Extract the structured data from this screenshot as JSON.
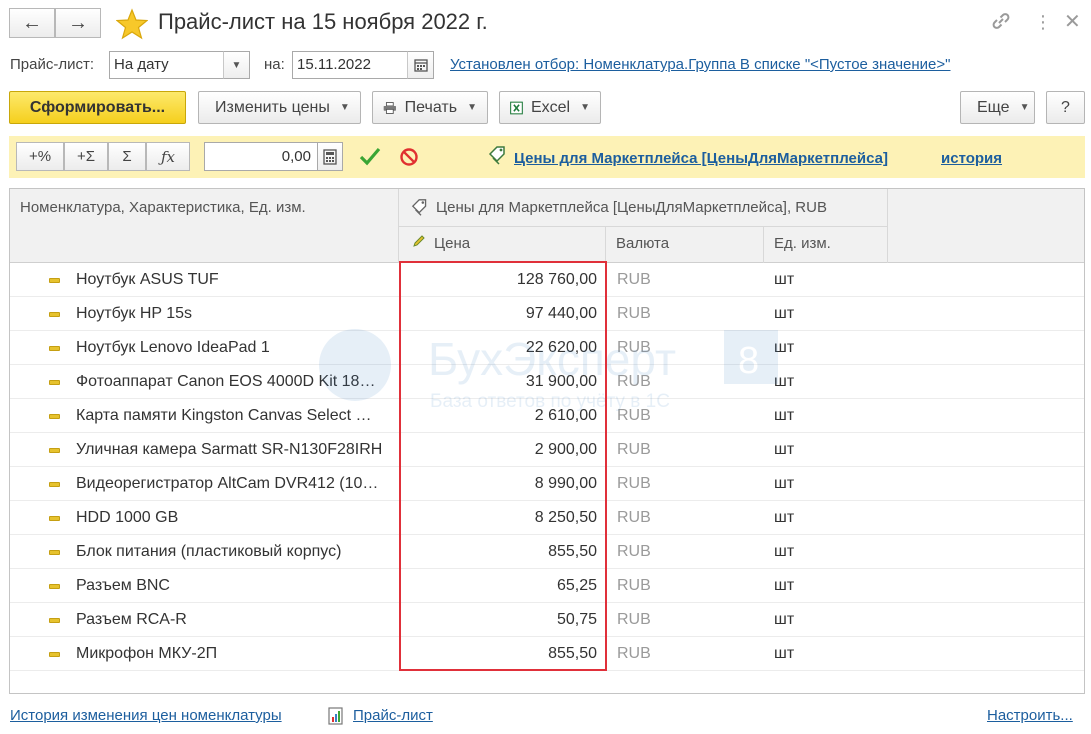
{
  "window": {
    "title": "Прайс-лист на 15 ноября 2022 г.",
    "back_icon": "arrow-left-icon",
    "forward_icon": "arrow-right-icon"
  },
  "params": {
    "pricelist_label": "Прайс-лист:",
    "pricelist_value": "На дату",
    "date_label": "на:",
    "date_value": "15.11.2022",
    "filter_link": "Установлен отбор: Номенклатура.Группа В списке \"<Пустое значение>\""
  },
  "toolbar": {
    "generate": "Сформировать...",
    "change_prices": "Изменить цены",
    "print": "Печать",
    "excel": "Excel",
    "more": "Еще",
    "help": "?"
  },
  "panel": {
    "pct": "+%",
    "add_sum": "+Σ",
    "sum": "Σ",
    "fx": "ƒx",
    "amount": "0,00",
    "price_type_link": "Цены для Маркетплейса [ЦеныДляМаркетплейса]",
    "history_link": "история"
  },
  "table": {
    "col_item": "Номенклатура, Характеристика, Ед. изм.",
    "group_header": "Цены для Маркетплейса [ЦеныДляМаркетплейса], RUB",
    "col_price": "Цена",
    "col_currency": "Валюта",
    "col_unit": "Ед. изм.",
    "rows": [
      {
        "name": "Ноутбук ASUS TUF",
        "price": "128 760,00",
        "currency": "RUB",
        "unit": "шт"
      },
      {
        "name": "Ноутбук HP 15s",
        "price": "97 440,00",
        "currency": "RUB",
        "unit": "шт"
      },
      {
        "name": "Ноутбук Lenovo IdeaPad 1",
        "price": "22 620,00",
        "currency": "RUB",
        "unit": "шт"
      },
      {
        "name": "Фотоаппарат Canon EOS 4000D Kit 18…",
        "price": "31 900,00",
        "currency": "RUB",
        "unit": "шт"
      },
      {
        "name": "Карта памяти Kingston Canvas Select …",
        "price": "2 610,00",
        "currency": "RUB",
        "unit": "шт"
      },
      {
        "name": "Уличная камера Sarmatt SR-N130F28IRH",
        "price": "2 900,00",
        "currency": "RUB",
        "unit": "шт"
      },
      {
        "name": "Видеорегистратор AltCam DVR412 (10…",
        "price": "8 990,00",
        "currency": "RUB",
        "unit": "шт"
      },
      {
        "name": "HDD 1000 GB",
        "price": "8 250,50",
        "currency": "RUB",
        "unit": "шт"
      },
      {
        "name": "Блок питания (пластиковый корпус)",
        "price": "855,50",
        "currency": "RUB",
        "unit": "шт"
      },
      {
        "name": "Разъем BNC",
        "price": "65,25",
        "currency": "RUB",
        "unit": "шт"
      },
      {
        "name": "Разъем RCA-R",
        "price": "50,75",
        "currency": "RUB",
        "unit": "шт"
      },
      {
        "name": "Микрофон МКУ-2П",
        "price": "855,50",
        "currency": "RUB",
        "unit": "шт"
      }
    ]
  },
  "footer": {
    "history_link": "История изменения цен номенклатуры",
    "pricelist_link": "Прайс-лист",
    "settings_link": "Настроить..."
  },
  "watermark": {
    "brand": "БухЭксперт",
    "number": "8",
    "tagline": "База ответов по учёту в 1С"
  },
  "colors": {
    "accent_yellow": "#f5cf1d",
    "panel_yellow": "#fdf2b6",
    "link_blue": "#1c5e9e",
    "highlight_red": "#e0303a",
    "ok_green": "#3aa534",
    "cancel_red": "#e03030"
  }
}
